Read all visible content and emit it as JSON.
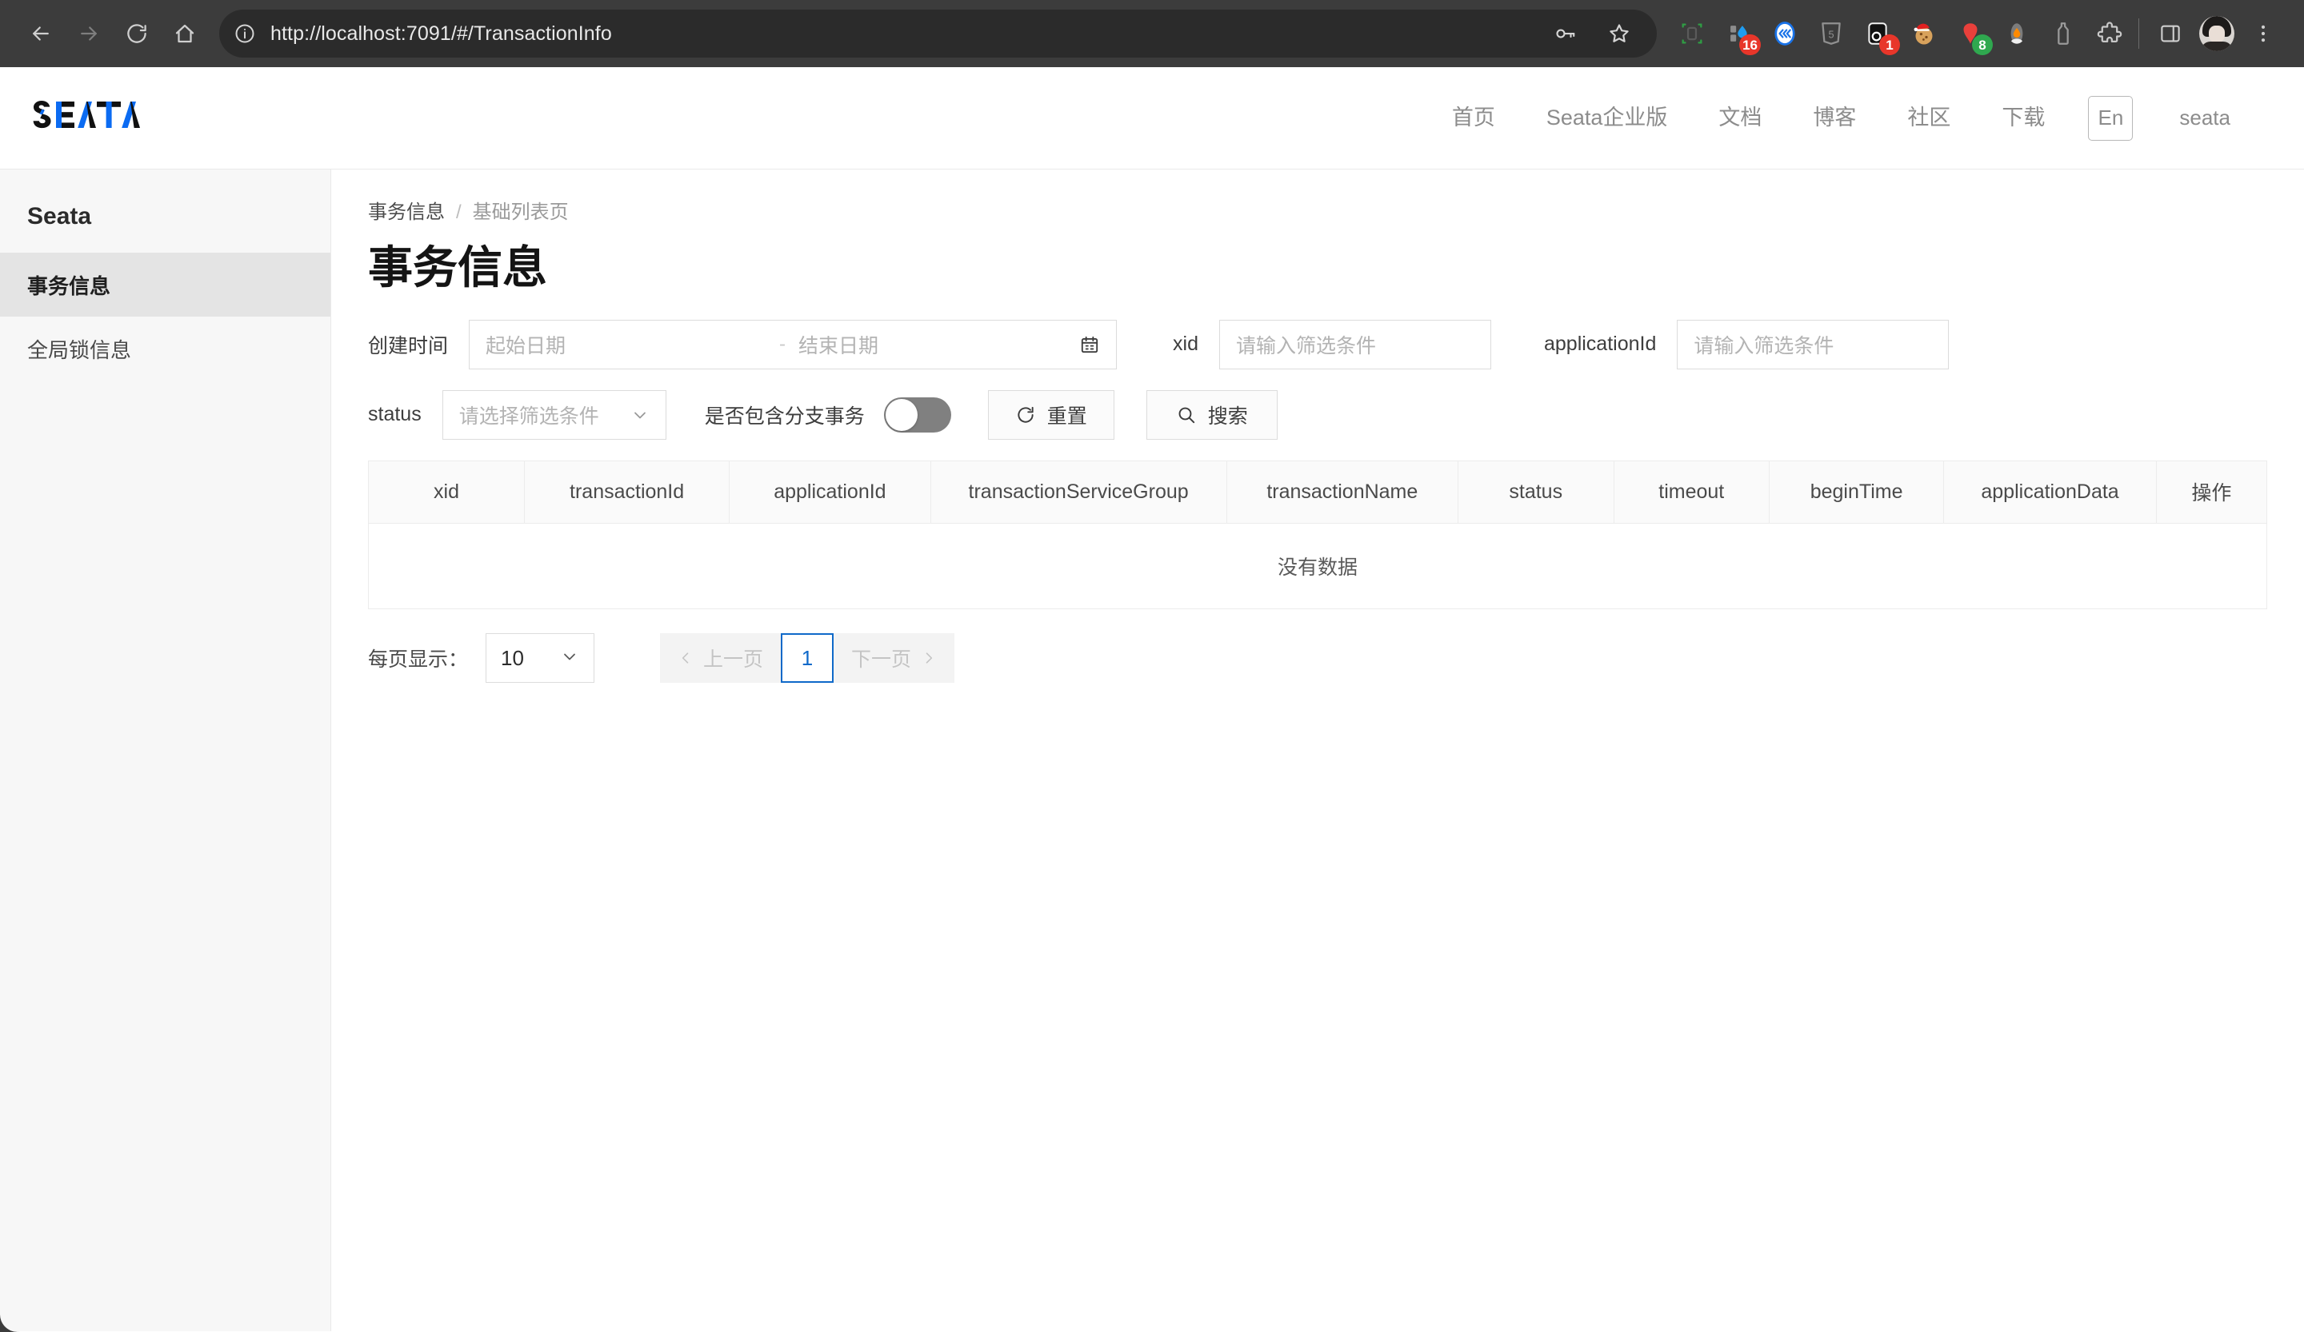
{
  "browser": {
    "url": "http://localhost:7091/#/TransactionInfo",
    "back_label": "Back",
    "forward_label": "Forward",
    "reload_label": "Reload",
    "home_label": "Home",
    "site_info_label": "View site information",
    "password_label": "Save password",
    "bookmark_label": "Bookmark this tab",
    "extensions_label": "Extensions",
    "side_panel_label": "Side panel",
    "menu_label": "Customize and control Chrome",
    "profile_label": "Profile",
    "extensions": [
      {
        "name": "tab-organizer-extension",
        "badge": "",
        "badge_color": ""
      },
      {
        "name": "droplet-extension",
        "badge": "16",
        "badge_color": "#e8362a"
      },
      {
        "name": "rewind-extension",
        "badge": "",
        "badge_color": ""
      },
      {
        "name": "html5-extension",
        "badge": "",
        "badge_color": ""
      },
      {
        "name": "dark-reader-extension",
        "badge": "1",
        "badge_color": "#e8362a"
      },
      {
        "name": "cookie-santa-extension",
        "badge": "",
        "badge_color": ""
      },
      {
        "name": "grammar-extension",
        "badge": "8",
        "badge_color": "#2fa84f"
      },
      {
        "name": "flame-extension",
        "badge": "",
        "badge_color": ""
      },
      {
        "name": "bottle-extension",
        "badge": "",
        "badge_color": ""
      }
    ]
  },
  "site_header": {
    "logo_text": "SEATA",
    "nav": [
      {
        "label": "首页"
      },
      {
        "label": "Seata企业版"
      },
      {
        "label": "文档"
      },
      {
        "label": "博客"
      },
      {
        "label": "社区"
      },
      {
        "label": "下载"
      }
    ],
    "language_toggle": "En",
    "user": "seata"
  },
  "sidebar": {
    "title": "Seata",
    "items": [
      {
        "label": "事务信息",
        "active": true
      },
      {
        "label": "全局锁信息",
        "active": false
      }
    ]
  },
  "breadcrumb": {
    "current": "事务信息",
    "separator": "/",
    "sub": "基础列表页"
  },
  "page_title": "事务信息",
  "filters": {
    "create_time_label": "创建时间",
    "date_start_placeholder": "起始日期",
    "date_separator": "-",
    "date_end_placeholder": "结束日期",
    "xid_label": "xid",
    "xid_placeholder": "请输入筛选条件",
    "application_id_label": "applicationId",
    "application_id_placeholder": "请输入筛选条件",
    "status_label": "status",
    "status_placeholder": "请选择筛选条件",
    "branch_toggle_label": "是否包含分支事务",
    "branch_toggle_on": false,
    "reset_label": "重置",
    "search_label": "搜索"
  },
  "table": {
    "columns": [
      "xid",
      "transactionId",
      "applicationId",
      "transactionServiceGroup",
      "transactionName",
      "status",
      "timeout",
      "beginTime",
      "applicationData",
      "操作"
    ],
    "rows": [],
    "empty_text": "没有数据"
  },
  "pagination": {
    "page_size_label": "每页显示：",
    "page_size_value": "10",
    "prev_label": "上一页",
    "next_label": "下一页",
    "current_page": "1"
  },
  "colors": {
    "accent_blue": "#0f69c9",
    "logo_blue": "#0b6bf2",
    "sidebar_bg": "#f7f7f7",
    "sidebar_active_bg": "#e4e4e4",
    "chrome_bg": "#3c3c3c",
    "toggle_off": "#808080"
  }
}
